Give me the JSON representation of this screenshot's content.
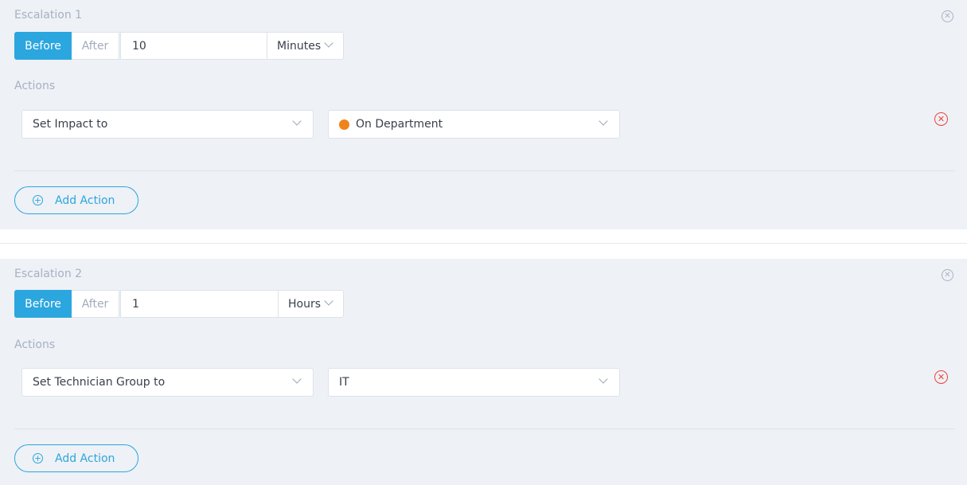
{
  "accent_color": "#2ba6de",
  "danger_color": "#e8453c",
  "escalations": [
    {
      "title": "Escalation 1",
      "timing": {
        "before_label": "Before",
        "after_label": "After",
        "selected": "Before"
      },
      "amount": "10",
      "unit": "Minutes",
      "actions_label": "Actions",
      "actions": [
        {
          "field": "Set Impact to",
          "value": "On Department",
          "value_color": "#f0831c"
        }
      ],
      "add_action_label": "Add Action"
    },
    {
      "title": "Escalation 2",
      "timing": {
        "before_label": "Before",
        "after_label": "After",
        "selected": "Before"
      },
      "amount": "1",
      "unit": "Hours",
      "actions_label": "Actions",
      "actions": [
        {
          "field": "Set Technician Group to",
          "value": "IT"
        }
      ],
      "add_action_label": "Add Action"
    }
  ],
  "icons": {
    "close": "close-circle-icon",
    "remove": "remove-circle-icon",
    "add": "plus-circle-icon",
    "dropdown": "chevron-down-icon"
  }
}
